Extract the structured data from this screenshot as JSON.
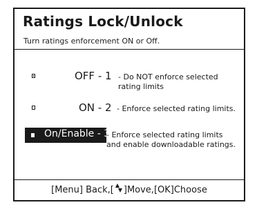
{
  "header": {
    "title": "Ratings Lock/Unlock",
    "subtitle": "Turn ratings enforcement ON or Off."
  },
  "options": [
    {
      "label": "OFF - 1",
      "separator": " - ",
      "description": "Do NOT enforce selected rating limits",
      "checked": true,
      "selected": false
    },
    {
      "label": "ON - 2",
      "separator": " - ",
      "description": "Enforce selected rating limits.",
      "checked": false,
      "selected": false
    },
    {
      "label": "On/Enable - 3",
      "separator": " - ",
      "description": "Enforce selected rating limits and enable downloadable ratings.",
      "checked": false,
      "selected": true
    }
  ],
  "footer": {
    "prefix": "[Menu] Back,[",
    "suffix": "]Move,[OK]Choose",
    "up_arrow": "▲",
    "down_arrow": "▼"
  },
  "colors": {
    "foreground": "#1a1a1a",
    "background": "#ffffff",
    "highlight": "#1a1a1a",
    "highlight_text": "#ffffff"
  }
}
